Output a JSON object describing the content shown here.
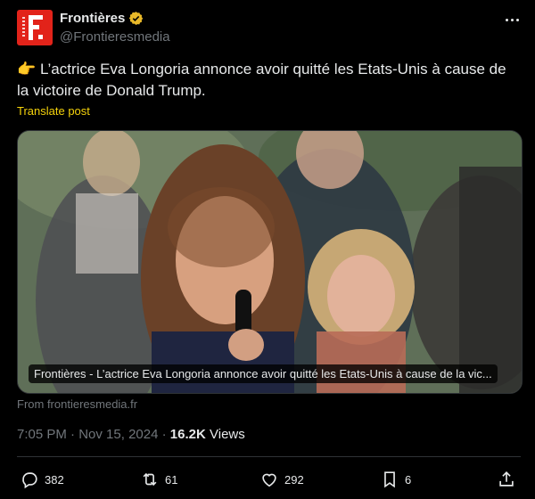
{
  "author": {
    "name": "Frontières",
    "handle": "@Frontieresmedia",
    "verified": true,
    "avatar_color": "#e2231a"
  },
  "post": {
    "emoji": "👉",
    "text": "L’actrice Eva Longoria annonce avoir quitté les Etats-Unis à cause de la victoire de Donald Trump.",
    "translate_label": "Translate post"
  },
  "card": {
    "caption": "Frontières - L’actrice Eva Longoria annonce avoir quitté les Etats-Unis à cause de la vic...",
    "from": "From frontieresmedia.fr"
  },
  "meta": {
    "time": "7:05 PM",
    "date": "Nov 15, 2024",
    "separator": "·",
    "views_count": "16.2K",
    "views_label": "Views"
  },
  "actions": {
    "replies": "382",
    "reposts": "61",
    "likes": "292",
    "bookmarks": "6"
  },
  "colors": {
    "background": "#000000",
    "text": "#e7e9ea",
    "muted": "#71767b",
    "accent": "#f4d20b",
    "divider": "#2f3336"
  }
}
